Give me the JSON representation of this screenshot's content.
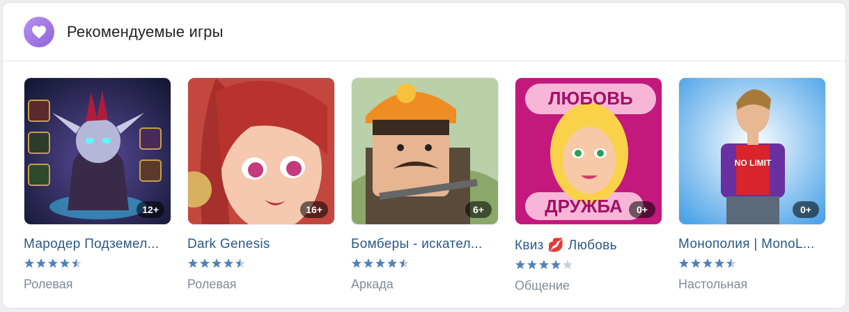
{
  "header": {
    "title": "Рекомендуемые игры",
    "icon": "heart-icon",
    "accent": "#9b72e3"
  },
  "games": [
    {
      "title": "Мародер Подземел...",
      "age": "12+",
      "rating": 4.5,
      "genre": "Ролевая",
      "cover": "fantasy-elf-art"
    },
    {
      "title": "Dark Genesis",
      "age": "16+",
      "rating": 4.5,
      "genre": "Ролевая",
      "cover": "anime-girl-art"
    },
    {
      "title": "Бомберы - искател...",
      "age": "6+",
      "rating": 4.5,
      "genre": "Аркада",
      "cover": "miner-character-art"
    },
    {
      "title": "Квиз 💋 Любовь",
      "age": "0+",
      "rating": 4,
      "genre": "Общение",
      "cover": "quiz-love-art",
      "cover_text_top": "ЛЮБОВЬ",
      "cover_text_bottom": "ДРУЖБА"
    },
    {
      "title": "Монополия | MonoL...",
      "age": "0+",
      "rating": 4.5,
      "genre": "Настольная",
      "cover": "no-limit-guy-art",
      "cover_text": "NO LIMIT"
    }
  ],
  "colors": {
    "title_link": "#2a5885",
    "star_filled": "#5181b8",
    "star_empty": "#c5d0db",
    "genre": "#818c99"
  }
}
